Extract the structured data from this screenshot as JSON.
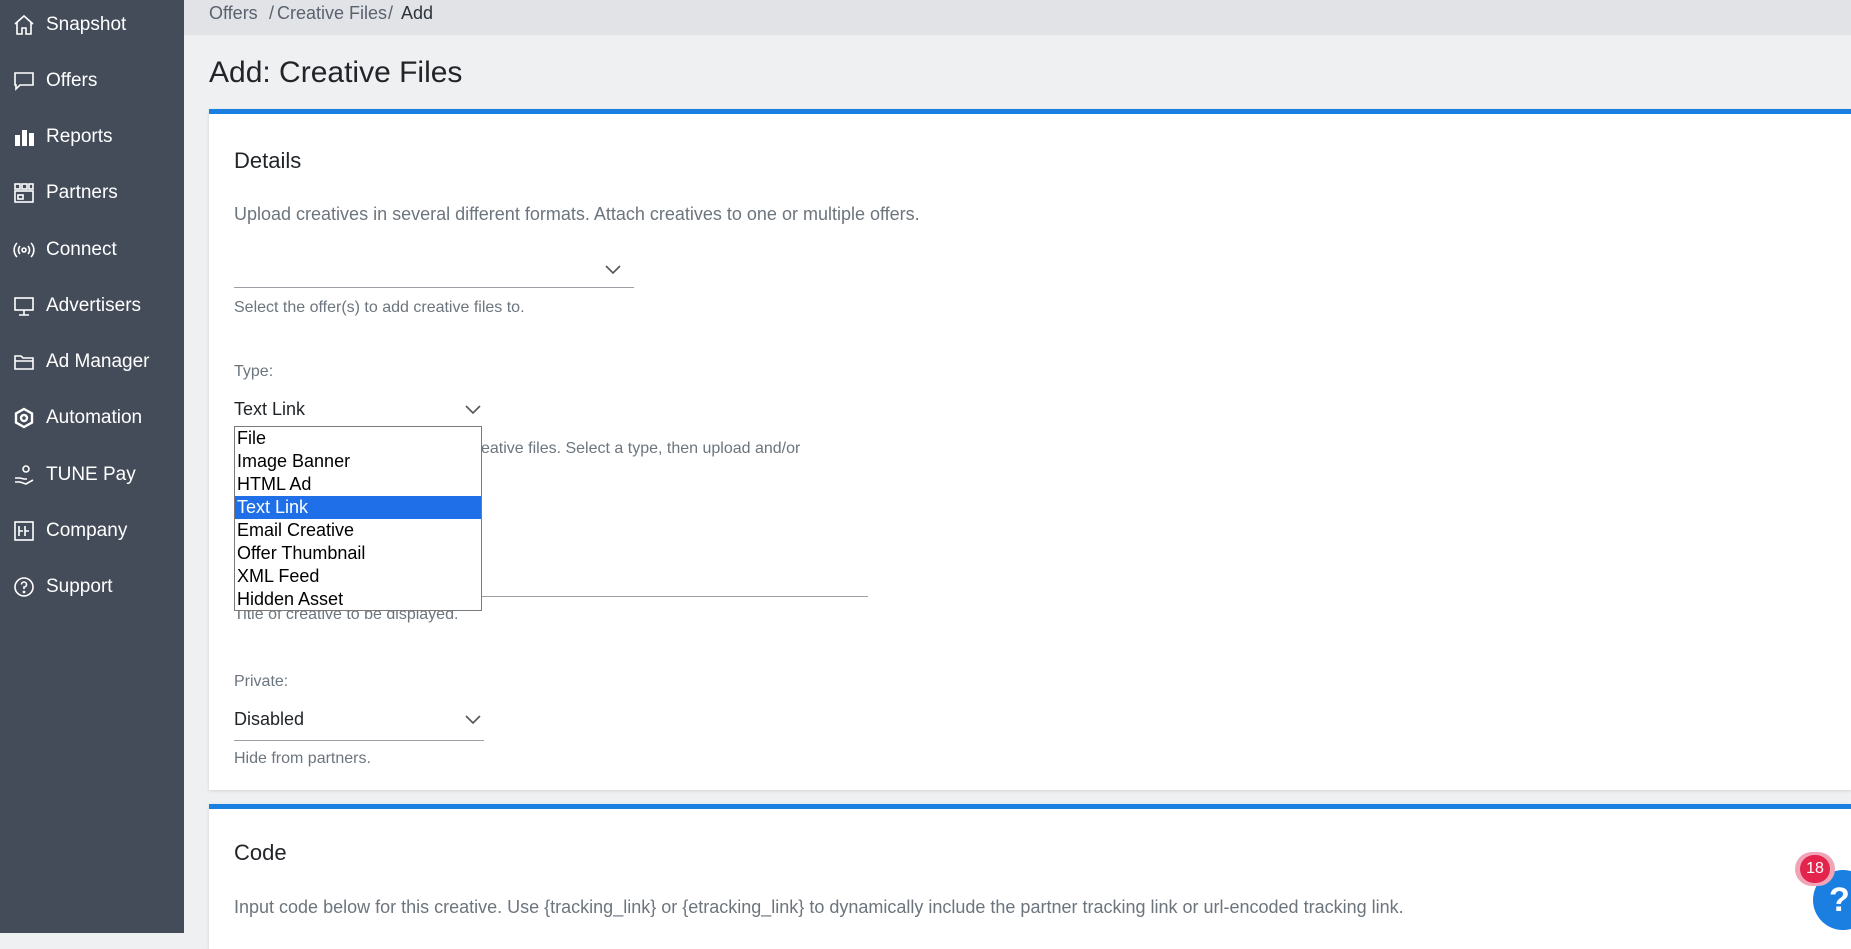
{
  "sidebar": {
    "items": [
      {
        "label": "Snapshot",
        "icon": "home-icon"
      },
      {
        "label": "Offers",
        "icon": "chat-icon"
      },
      {
        "label": "Reports",
        "icon": "bar-chart-icon"
      },
      {
        "label": "Partners",
        "icon": "partners-icon"
      },
      {
        "label": "Connect",
        "icon": "broadcast-icon"
      },
      {
        "label": "Advertisers",
        "icon": "billboard-icon"
      },
      {
        "label": "Ad Manager",
        "icon": "folder-icon"
      },
      {
        "label": "Automation",
        "icon": "hexagon-icon"
      },
      {
        "label": "TUNE Pay",
        "icon": "hand-coin-icon"
      },
      {
        "label": "Company",
        "icon": "company-icon"
      },
      {
        "label": "Support",
        "icon": "help-circle-icon"
      }
    ]
  },
  "breadcrumb": {
    "items": [
      "Offers",
      "Creative Files",
      "Add"
    ],
    "separator": "/"
  },
  "page_title": "Add: Creative Files",
  "details": {
    "title": "Details",
    "description": "Upload creatives in several different formats. Attach creatives to one or multiple offers.",
    "offers_value": "",
    "offers_help": "Select the offer(s) to add creative files to.",
    "type_label": "Type:",
    "type_value": "Text Link",
    "type_help_visible": "eative files. Select a type, then upload and/or",
    "name_help_visible": "Title of creative to be displayed.",
    "private_label": "Private:",
    "private_value": "Disabled",
    "private_help": "Hide from partners."
  },
  "type_dropdown": {
    "options": [
      "File",
      "Image Banner",
      "HTML Ad",
      "Text Link",
      "Email Creative",
      "Offer Thumbnail",
      "XML Feed",
      "Hidden Asset"
    ],
    "selected": "Text Link"
  },
  "code": {
    "title": "Code",
    "description": "Input code below for this creative. Use {tracking_link} or {etracking_link} to dynamically include the partner tracking link or url-encoded tracking link."
  },
  "notification": {
    "count": "18"
  },
  "help_button": {
    "label": "?"
  },
  "colors": {
    "sidebar_bg": "#444c59",
    "accent": "#1a7fe0",
    "selected_option": "#1e6fe8",
    "badge": "#e3254d"
  }
}
